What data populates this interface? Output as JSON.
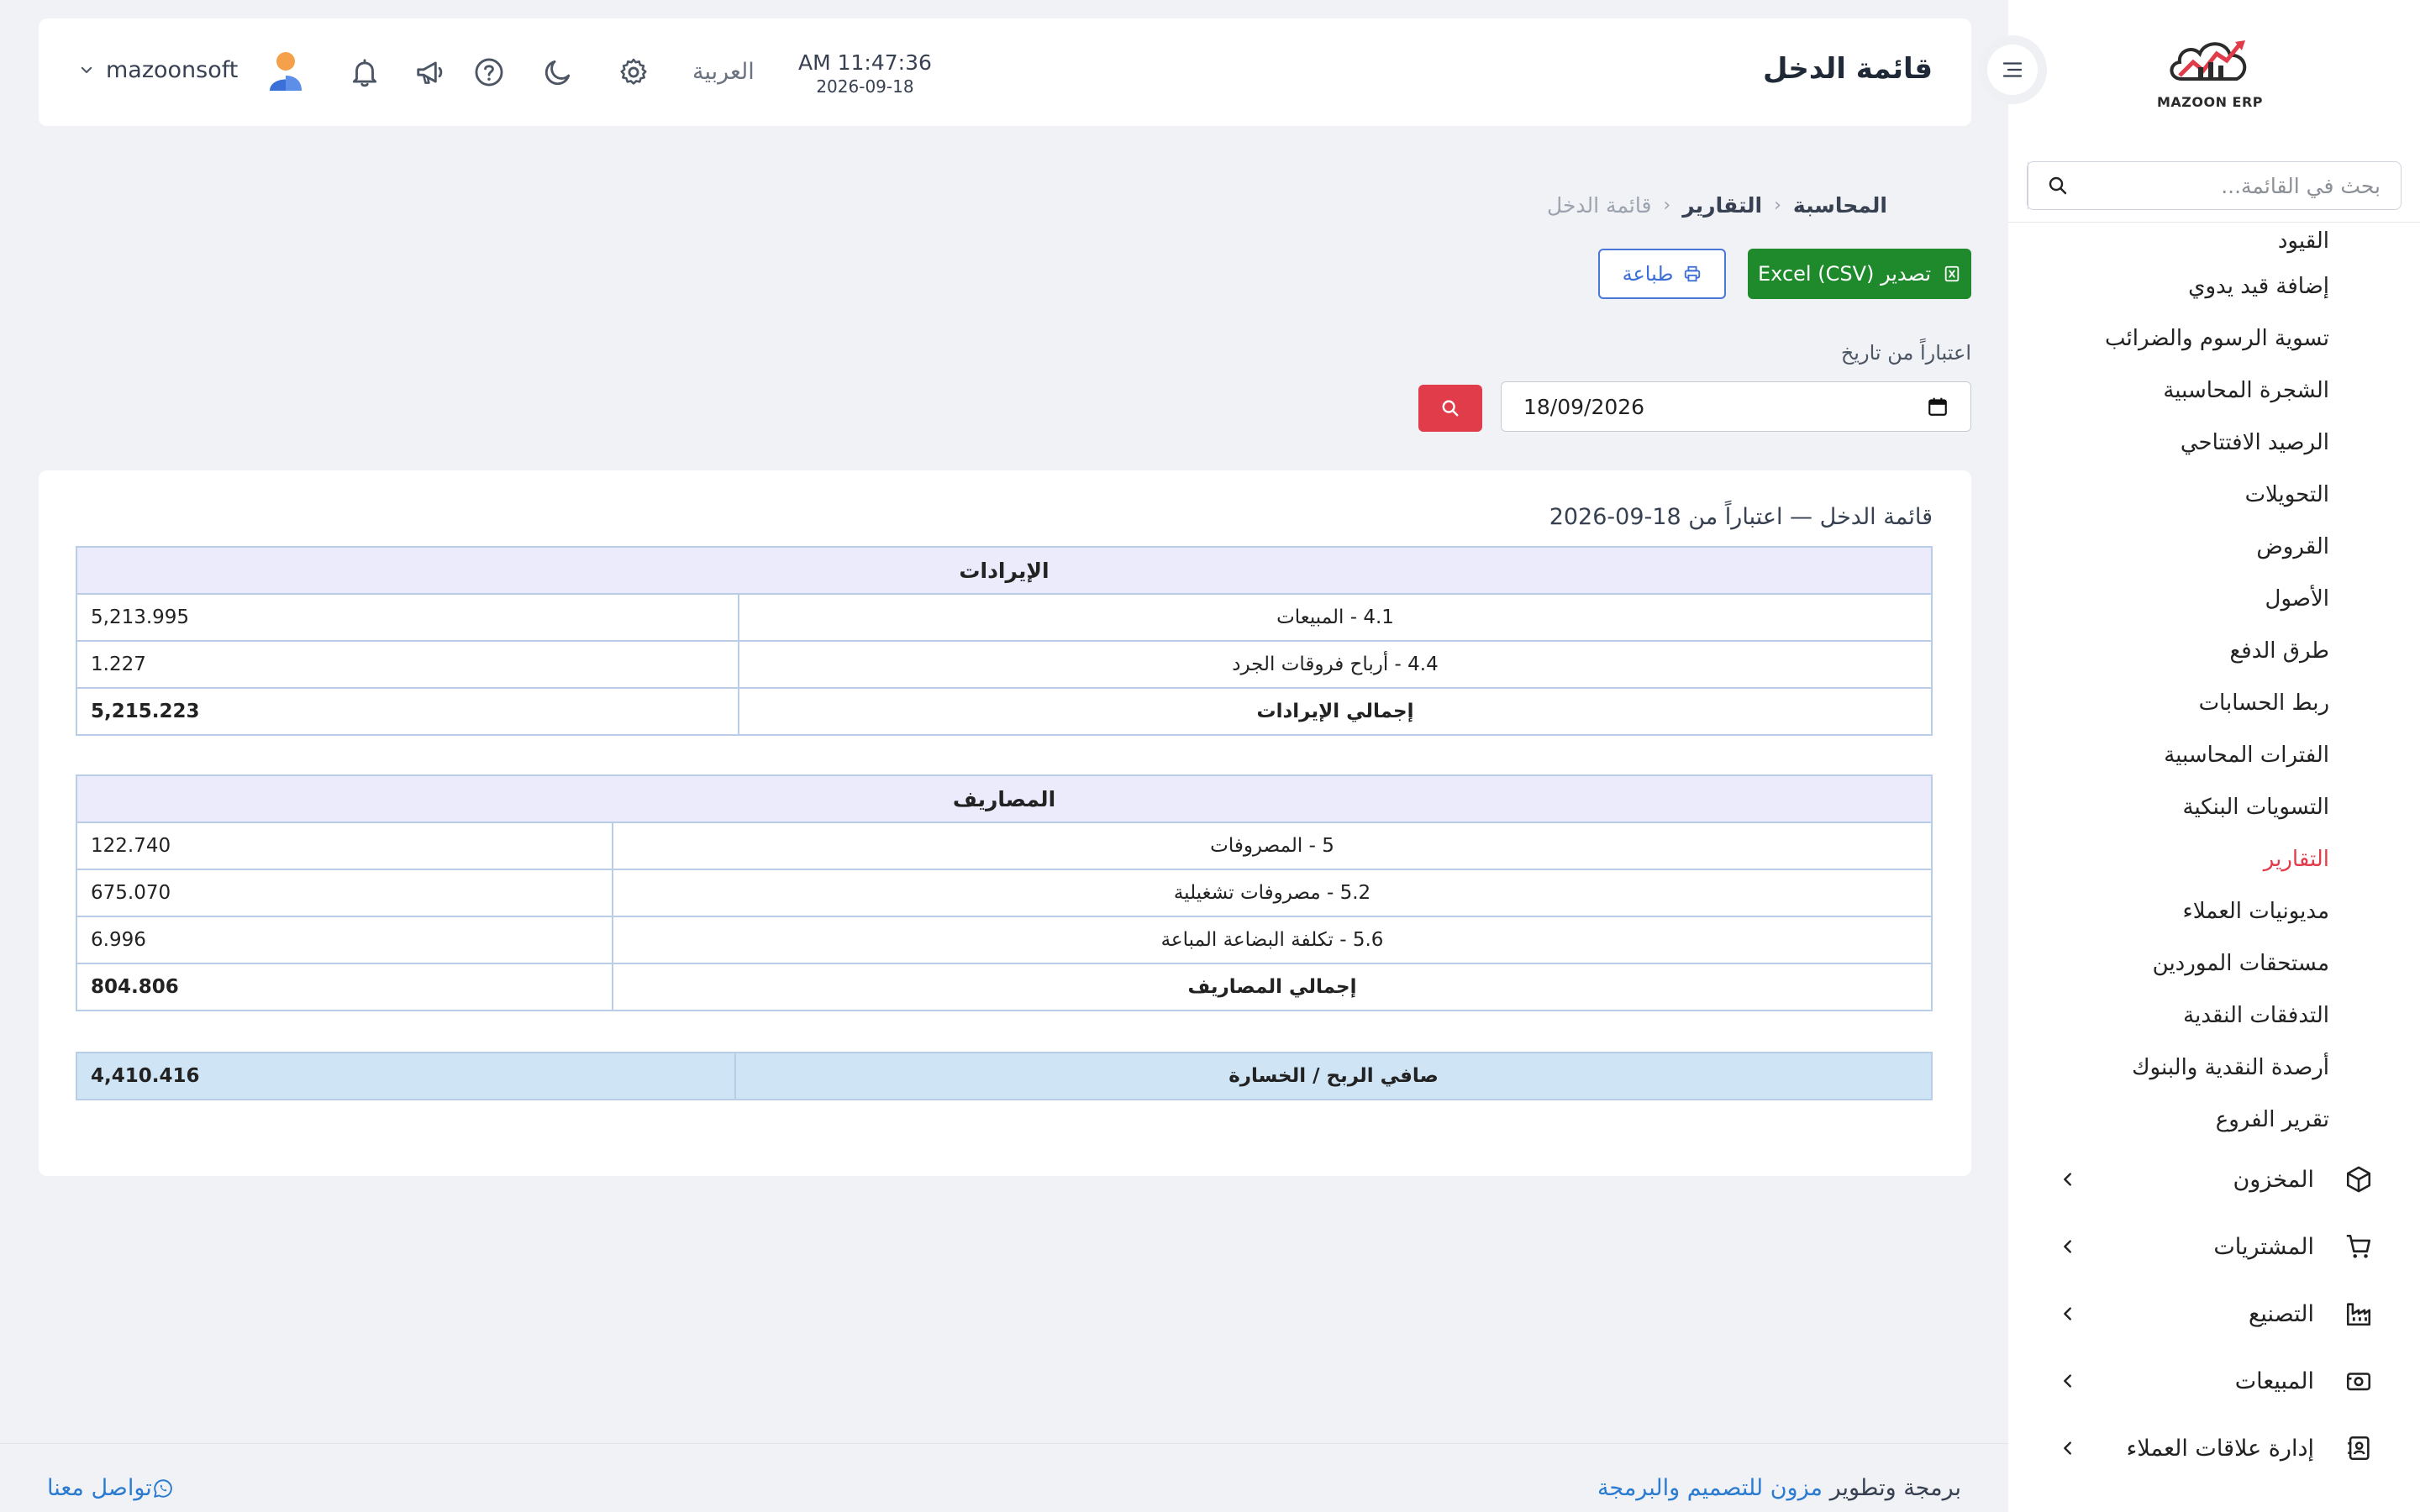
{
  "colors": {
    "accent_red": "#e03c4a",
    "export_green": "#1e8a2c",
    "print_blue": "#4a78d8",
    "link_blue": "#2b7bd0",
    "table_header_bg": "#ebebfb",
    "net_row_bg": "#cfe4f4"
  },
  "sidebar": {
    "logo_text": "MAZOON ERP",
    "logo_small_text": "ERP",
    "search_placeholder": "بحث في القائمة...",
    "items": [
      {
        "label": "القيود",
        "icon": "none"
      },
      {
        "label": "إضافة قيد يدوي",
        "icon": "none"
      },
      {
        "label": "تسوية الرسوم والضرائب",
        "icon": "none"
      },
      {
        "label": "الشجرة المحاسبية",
        "icon": "none"
      },
      {
        "label": "الرصيد الافتتاحي",
        "icon": "none"
      },
      {
        "label": "التحويلات",
        "icon": "none"
      },
      {
        "label": "القروض",
        "icon": "none"
      },
      {
        "label": "الأصول",
        "icon": "none"
      },
      {
        "label": "طرق الدفع",
        "icon": "none"
      },
      {
        "label": "ربط الحسابات",
        "icon": "none"
      },
      {
        "label": "الفترات المحاسبية",
        "icon": "none"
      },
      {
        "label": "التسويات البنكية",
        "icon": "none"
      },
      {
        "label": "التقارير",
        "icon": "none",
        "active": true
      },
      {
        "label": "مديونيات العملاء",
        "icon": "none"
      },
      {
        "label": "مستحقات الموردين",
        "icon": "none"
      },
      {
        "label": "التدفقات النقدية",
        "icon": "none"
      },
      {
        "label": "أرصدة النقدية والبنوك",
        "icon": "none"
      },
      {
        "label": "تقرير الفروع",
        "icon": "none"
      }
    ],
    "groups": [
      {
        "label": "المخزون",
        "icon": "box-icon"
      },
      {
        "label": "المشتريات",
        "icon": "cart-icon"
      },
      {
        "label": "التصنيع",
        "icon": "factory-icon"
      },
      {
        "label": "المبيعات",
        "icon": "cash-register-icon"
      },
      {
        "label": "إدارة علاقات العملاء",
        "icon": "contact-book-icon"
      }
    ]
  },
  "header": {
    "page_title": "قائمة الدخل",
    "time": "AM 11:47:36",
    "date": "2026-09-18",
    "language": "العربية",
    "username": "mazoonsoft",
    "icons": [
      "settings-icon",
      "moon-icon",
      "help-icon",
      "megaphone-icon",
      "bell-icon"
    ]
  },
  "breadcrumb": {
    "items": [
      "المحاسبة",
      "التقارير",
      "قائمة الدخل"
    ],
    "separator": "‹"
  },
  "actions": {
    "export_label": "تصدير Excel (CSV)",
    "print_label": "طباعة"
  },
  "filter": {
    "label": "اعتباراً من تاريخ",
    "date_value": "18/09/2026"
  },
  "report": {
    "title": "قائمة الدخل — اعتباراً من 18-09-2026",
    "revenue": {
      "header": "الإيرادات",
      "rows": [
        {
          "label": "4.1 - المبيعات",
          "value": "5,213.995"
        },
        {
          "label": "4.4 - أرباح فروقات الجرد",
          "value": "1.227"
        }
      ],
      "total_label": "إجمالي الإيرادات",
      "total_value": "5,215.223"
    },
    "expenses": {
      "header": "المصاريف",
      "rows": [
        {
          "label": "5 - المصروفات",
          "value": "122.740"
        },
        {
          "label": "5.2 - مصروفات تشغيلية",
          "value": "675.070"
        },
        {
          "label": "5.6 - تكلفة البضاعة المباعة",
          "value": "6.996"
        }
      ],
      "total_label": "إجمالي المصاريف",
      "total_value": "804.806"
    },
    "net": {
      "label": "صافي الربح / الخسارة",
      "value": "4,410.416"
    }
  },
  "footer": {
    "credit_prefix": "برمجة وتطوير",
    "credit_link": "مزون للتصميم والبرمجة",
    "contact": "تواصل معنا"
  }
}
